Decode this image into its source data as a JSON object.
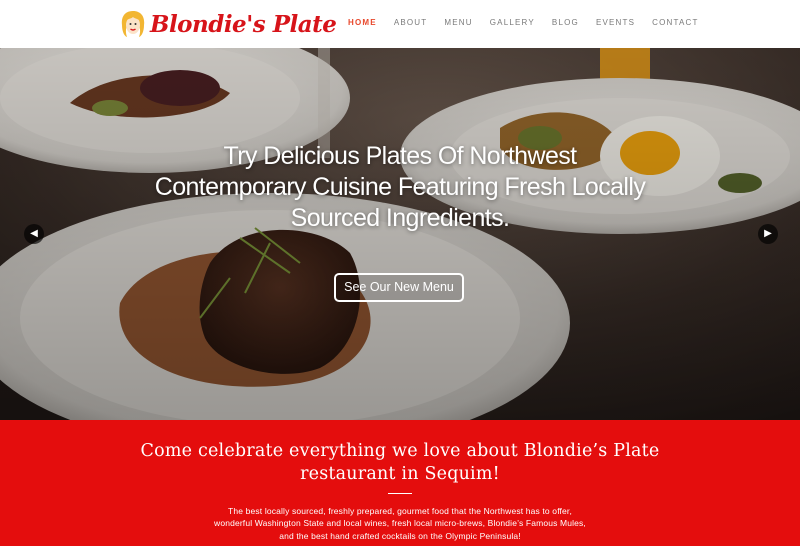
{
  "brand": {
    "name": "Blondie's Plate",
    "accent": "#d7141a"
  },
  "nav": {
    "items": [
      {
        "label": "HOME",
        "active": true
      },
      {
        "label": "ABOUT"
      },
      {
        "label": "MENU"
      },
      {
        "label": "GALLERY"
      },
      {
        "label": "BLOG"
      },
      {
        "label": "EVENTS"
      },
      {
        "label": "CONTACT"
      }
    ]
  },
  "hero": {
    "headline": "Try Delicious Plates Of Northwest Contemporary Cuisine Featuring Fresh Locally Sourced Ingredients.",
    "cta_label": "See Our New Menu",
    "prev_icon": "chevron-left-icon",
    "next_icon": "chevron-right-icon"
  },
  "intro": {
    "background": "#e40d0d",
    "title": "Come celebrate everything we love about Blondie’s Plate restaurant in Sequim!",
    "body": "The best locally sourced, freshly prepared, gourmet food that the Northwest has to offer, wonderful Washington State and local wines, fresh local micro-brews, Blondie’s Famous Mules, and the best hand crafted cocktails on the Olympic Peninsula!"
  }
}
